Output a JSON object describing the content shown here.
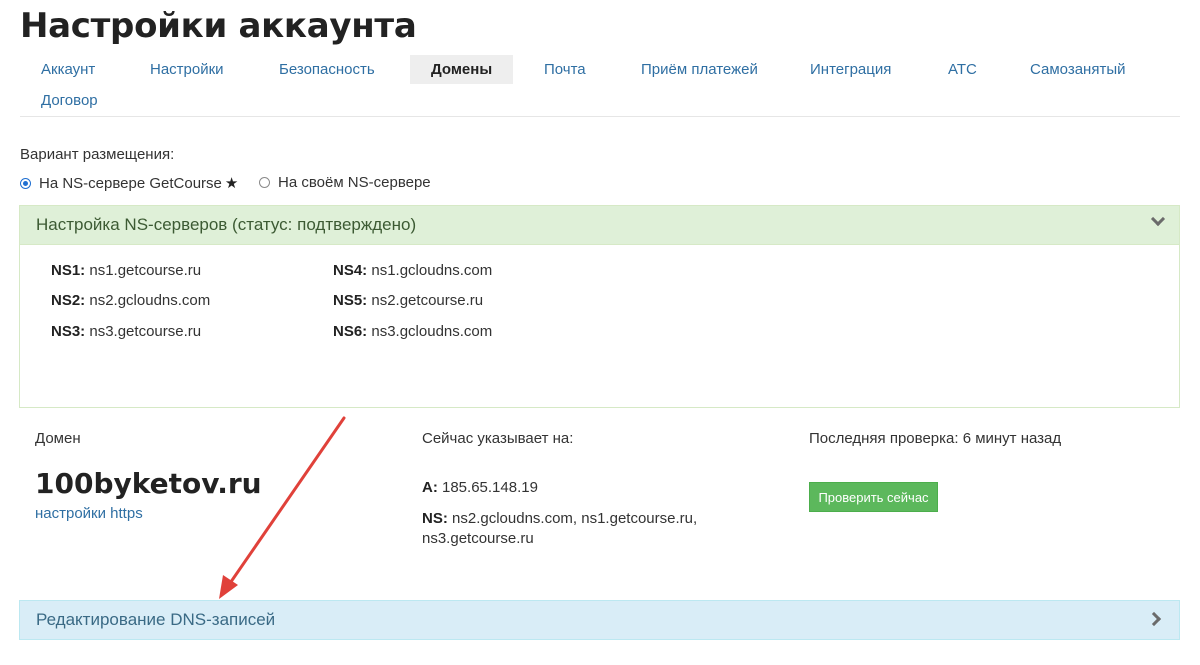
{
  "page": {
    "title": "Настройки аккаунта"
  },
  "tabs": [
    {
      "label": "Аккаунт",
      "active": false
    },
    {
      "label": "Настройки",
      "active": false
    },
    {
      "label": "Безопасность",
      "active": false
    },
    {
      "label": "Домены",
      "active": true
    },
    {
      "label": "Почта",
      "active": false
    },
    {
      "label": "Приём платежей",
      "active": false
    },
    {
      "label": "Интеграция",
      "active": false
    },
    {
      "label": "АТС",
      "active": false
    },
    {
      "label": "Самозанятый",
      "active": false
    },
    {
      "label": "Договор",
      "active": false
    }
  ],
  "placement": {
    "label": "Вариант размещения:",
    "option1": "На NS-сервере GetCourse",
    "option1_selected": true,
    "option2": "На своём NS-сервере",
    "option2_selected": false
  },
  "ns_panel": {
    "title": "Настройка NS-серверов (статус: подтверждено)",
    "servers": [
      {
        "key": "NS1:",
        "value": "ns1.getcourse.ru"
      },
      {
        "key": "NS2:",
        "value": "ns2.gcloudns.com"
      },
      {
        "key": "NS3:",
        "value": "ns3.getcourse.ru"
      },
      {
        "key": "NS4:",
        "value": "ns1.gcloudns.com"
      },
      {
        "key": "NS5:",
        "value": "ns2.getcourse.ru"
      },
      {
        "key": "NS6:",
        "value": "ns3.gcloudns.com"
      }
    ]
  },
  "domain": {
    "label": "Домен",
    "name": "100byketov.ru",
    "https_link": "настройки https",
    "points_label": "Сейчас указывает на:",
    "a_key": "A:",
    "a_value": "185.65.148.19",
    "ns_key": "NS:",
    "ns_value_line1": "ns2.gcloudns.com, ns1.getcourse.ru,",
    "ns_value_line2": "ns3.getcourse.ru",
    "last_check": "Последняя проверка: 6 минут назад",
    "check_button": "Проверить сейчас"
  },
  "dns_panel": {
    "title": "Редактирование DNS-записей"
  },
  "colors": {
    "link": "#2f6fa3",
    "success_panel": "#dff0d8",
    "info_panel": "#d9edf7",
    "button_green": "#5cb85c",
    "arrow_red": "#e0413a"
  },
  "icons": {
    "favorite": "star-icon",
    "expand": "chevron-down-icon",
    "collapse": "chevron-right-icon",
    "annotation": "red-arrow-icon"
  }
}
